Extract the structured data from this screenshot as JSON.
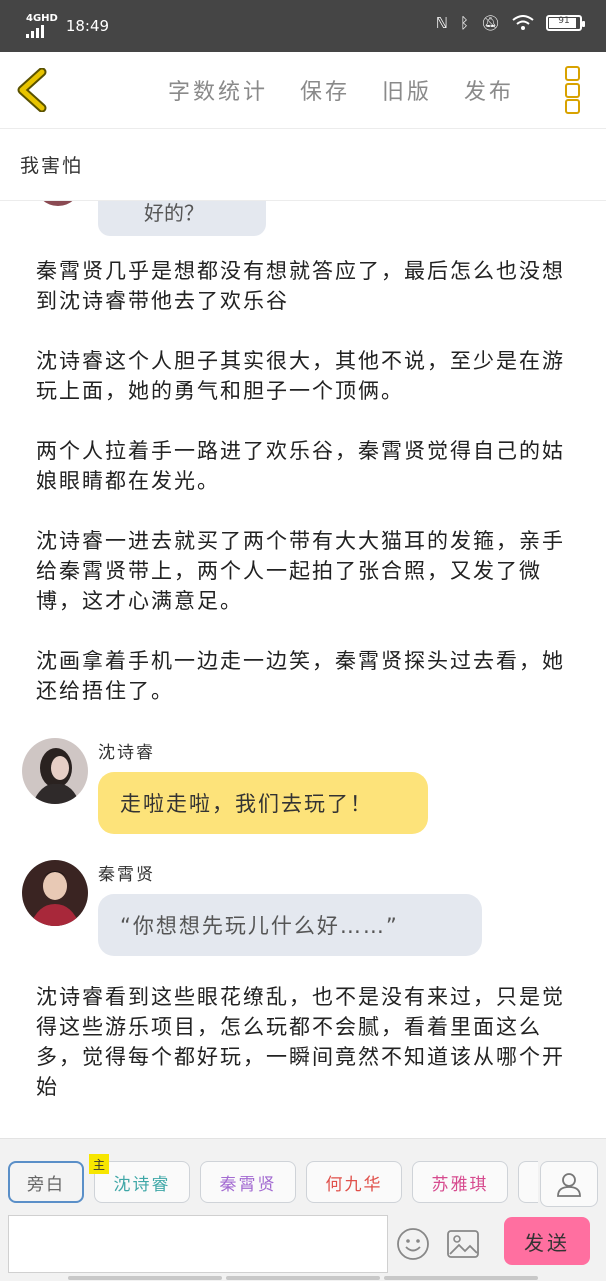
{
  "status_bar": {
    "network": "4GHD",
    "time": "18:49",
    "battery_level": 0.9,
    "battery_text": "91"
  },
  "nav": {
    "actions": [
      "字数统计",
      "保存",
      "旧版",
      "发布"
    ]
  },
  "title": "我害怕",
  "content": {
    "partial_bubble_text": "好的？",
    "paragraphs_top": [
      "秦霄贤几乎是想都没有想就答应了，最后怎么也没想到沈诗睿带他去了欢乐谷",
      "沈诗睿这个人胆子其实很大，其他不说，至少是在游玩上面，她的勇气和胆子一个顶俩。",
      "两个人拉着手一路进了欢乐谷，秦霄贤觉得自己的姑娘眼睛都在发光。",
      "沈诗睿一进去就买了两个带有大大猫耳的发箍，亲手给秦霄贤带上，两个人一起拍了张合照，又发了微博，这才心满意足。",
      "沈画拿着手机一边走一边笑，秦霄贤探头过去看，她还给捂住了。"
    ],
    "dialog_1": {
      "name": "沈诗睿",
      "text": "走啦走啦，我们去玩了！"
    },
    "dialog_2": {
      "name": "秦霄贤",
      "text": "“你想想先玩儿什么好……”"
    },
    "paragraph_bottom": "沈诗睿看到这些眼花缭乱，也不是没有来过，只是觉得这些游乐项目，怎么玩都不会腻，看着里面这么多，觉得每个都好玩，一瞬间竟然不知道该从哪个开始"
  },
  "bottom": {
    "roles": [
      {
        "label": "旁白",
        "color": "#666666"
      },
      {
        "label": "沈诗睿",
        "color": "#3fa7a7",
        "badge": "主"
      },
      {
        "label": "秦霄贤",
        "color": "#a36bd1"
      },
      {
        "label": "何九华",
        "color": "#e0504a"
      },
      {
        "label": "苏雅琪",
        "color": "#d64a8e"
      }
    ],
    "input_value": "",
    "input_placeholder": "",
    "send_label": "发送"
  },
  "colors": {
    "accent_yellow": "#d8a200",
    "bubble_yellow": "#fde37a",
    "bubble_gray": "#e4e8ef",
    "send_pink": "#ff6fa0"
  },
  "icons": [
    "back-chevron-icon",
    "menu-icon",
    "emoji-icon",
    "image-icon",
    "user-icon"
  ]
}
